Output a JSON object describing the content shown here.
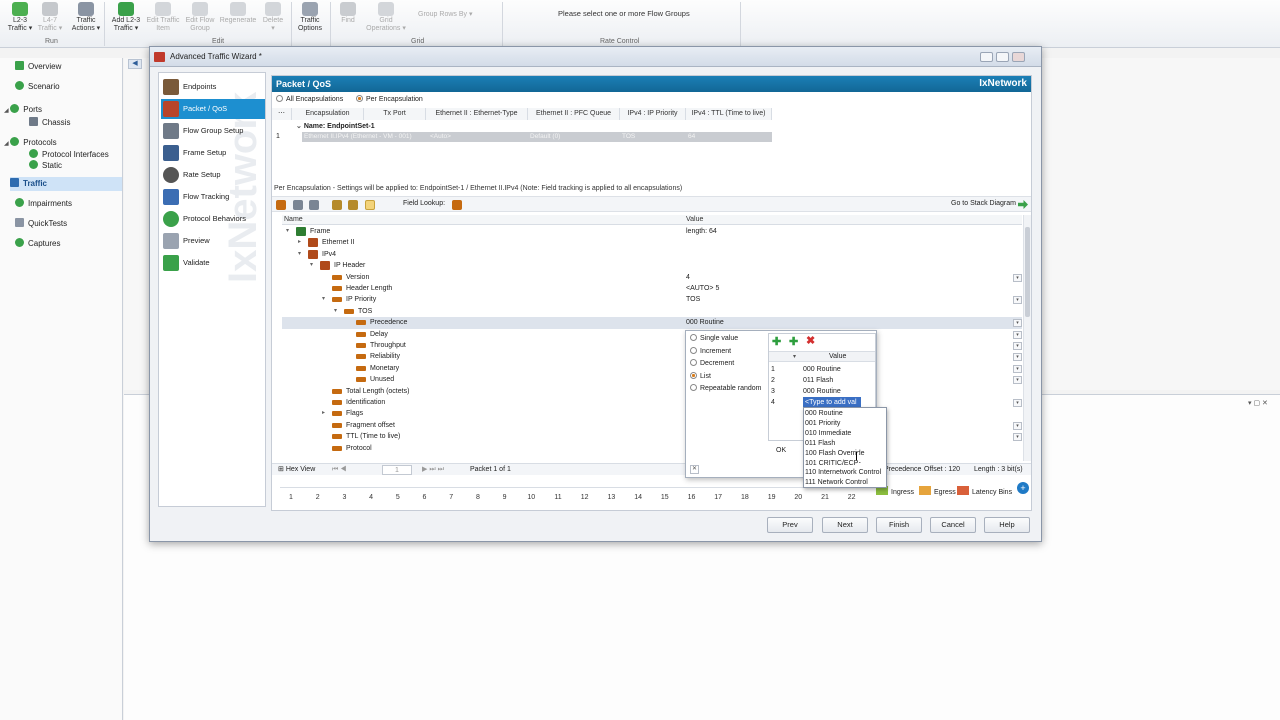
{
  "ribbon": {
    "buttons": [
      {
        "label": "L2-3\nTraffic ▾",
        "enabled": true
      },
      {
        "label": "L4-7\nTraffic ▾",
        "enabled": false
      },
      {
        "label": "Traffic\nActions ▾",
        "enabled": true
      },
      {
        "label": "Add L2-3\nTraffic ▾",
        "enabled": true
      },
      {
        "label": "Edit Traffic\nItem",
        "enabled": false
      },
      {
        "label": "Edit Flow\nGroup",
        "enabled": false
      },
      {
        "label": "Regenerate",
        "enabled": false
      },
      {
        "label": "Delete\n▾",
        "enabled": false
      },
      {
        "label": "Traffic\nOptions",
        "enabled": true
      },
      {
        "label": "Find",
        "enabled": false
      },
      {
        "label": "Grid\nOperations ▾",
        "enabled": false
      }
    ],
    "group_rows_by": "Group Rows By ▾",
    "groups": {
      "run": "Run",
      "edit": "Edit",
      "grid": "Grid",
      "rate_control": "Rate Control"
    },
    "rate_control_message": "Please select one or more Flow Groups"
  },
  "leftnav": {
    "items": [
      {
        "label": "Overview",
        "color": "#2e9e3e"
      },
      {
        "label": "Scenario",
        "color": "#2e9e3e"
      },
      {
        "label": "Ports",
        "color": "#2e9e3e"
      },
      {
        "label": "Chassis",
        "color": "#2e9e3e"
      },
      {
        "label": "Protocols",
        "color": "#2e9e3e"
      },
      {
        "label": "Protocol Interfaces",
        "color": "#2e9e3e"
      },
      {
        "label": "Static",
        "color": "#2e9e3e"
      },
      {
        "label": "Traffic",
        "color": "#2e9e3e"
      },
      {
        "label": "Impairments",
        "color": "#2e9e3e"
      },
      {
        "label": "QuickTests",
        "color": "#2e9e3e"
      },
      {
        "label": "Captures",
        "color": "#2e9e3e"
      }
    ]
  },
  "wizard": {
    "title": "Advanced Traffic Wizard *",
    "steps": [
      "Endpoints",
      "Packet / QoS",
      "Flow Group Setup",
      "Frame Setup",
      "Rate Setup",
      "Flow Tracking",
      "Protocol Behaviors",
      "Preview",
      "Validate"
    ],
    "watermark": "IxNetwork",
    "header": "Packet / QoS",
    "brand": "IxNetwork",
    "radio_all": "All Encapsulations",
    "radio_per": "Per Encapsulation",
    "columns": [
      "Encapsulation",
      "Tx Port",
      "Ethernet II : Ethernet-Type",
      "Ethernet II : PFC Queue",
      "IPv4 : IP Priority",
      "IPv4 : TTL (Time to live)"
    ],
    "endpoint_set": "Name: EndpointSet-1",
    "row_index": "1",
    "row_cells": [
      "Ethernet II.IPv4 (Ethernet - VM - 001)",
      "<Auto>",
      "Default (0)",
      "TOS",
      "64"
    ],
    "note": "Per Encapsulation - Settings will be applied to: EndpointSet-1 / Ethernet II.IPv4  (Note: Field tracking is applied to all encapsulations)",
    "field_lookup": "Field Lookup:",
    "stack_diagram": "Go to Stack Diagram",
    "grid_head": {
      "name": "Name",
      "value": "Value"
    },
    "tree": [
      {
        "name": "Frame",
        "value": "length: 64",
        "level": 0,
        "dd": false
      },
      {
        "name": "Ethernet II",
        "value": "",
        "level": 1,
        "dd": false
      },
      {
        "name": "IPv4",
        "value": "",
        "level": 1,
        "dd": false
      },
      {
        "name": "IP Header",
        "value": "",
        "level": 2,
        "dd": false
      },
      {
        "name": "Version",
        "value": "4",
        "level": 3,
        "dd": true
      },
      {
        "name": "Header Length",
        "value": "<AUTO> 5",
        "level": 3,
        "dd": false
      },
      {
        "name": "IP Priority",
        "value": "TOS",
        "level": 3,
        "dd": true
      },
      {
        "name": "TOS",
        "value": "",
        "level": 4,
        "dd": false
      },
      {
        "name": "Precedence",
        "value": "000 Routine",
        "level": 5,
        "dd": true
      },
      {
        "name": "Delay",
        "value": "",
        "level": 5,
        "dd": true
      },
      {
        "name": "Throughput",
        "value": "",
        "level": 5,
        "dd": true
      },
      {
        "name": "Reliability",
        "value": "",
        "level": 5,
        "dd": true
      },
      {
        "name": "Monetary",
        "value": "",
        "level": 5,
        "dd": true
      },
      {
        "name": "Unused",
        "value": "",
        "level": 5,
        "dd": true
      },
      {
        "name": "Total Length (octets)",
        "value": "",
        "level": 3,
        "dd": false
      },
      {
        "name": "Identification",
        "value": "",
        "level": 3,
        "dd": true
      },
      {
        "name": "Flags",
        "value": "",
        "level": 3,
        "dd": false
      },
      {
        "name": "Fragment offset",
        "value": "",
        "level": 3,
        "dd": true
      },
      {
        "name": "TTL (Time to live)",
        "value": "",
        "level": 3,
        "dd": true
      },
      {
        "name": "Protocol",
        "value": "",
        "level": 3,
        "dd": false
      }
    ],
    "hexbar": {
      "hex_view": "Hex View",
      "page": "1",
      "packet": "Packet 1 of 1",
      "precedence": "Precedence",
      "offset": "Offset : 120",
      "length": "Length : 3 bit(s)"
    },
    "ruler": [
      "1",
      "2",
      "3",
      "4",
      "5",
      "6",
      "7",
      "8",
      "9",
      "10",
      "11",
      "12",
      "13",
      "14",
      "15",
      "16",
      "17",
      "18",
      "19",
      "20",
      "21",
      "22"
    ],
    "legend": [
      {
        "label": "Ingress",
        "color": "#8cbf3f"
      },
      {
        "label": "Egress",
        "color": "#e6a43c"
      },
      {
        "label": "Latency Bins",
        "color": "#d9603a"
      }
    ],
    "footer": [
      "Prev",
      "Next",
      "Finish",
      "Cancel",
      "Help"
    ]
  },
  "popup": {
    "modes": [
      "Single value",
      "Increment",
      "Decrement",
      "List",
      "Repeatable random"
    ],
    "selected_mode": "List",
    "list_header": "Value",
    "list": [
      {
        "i": "1",
        "v": "000 Routine"
      },
      {
        "i": "2",
        "v": "011 Flash"
      },
      {
        "i": "3",
        "v": "000 Routine"
      },
      {
        "i": "4",
        "v": "<Type to add val"
      }
    ],
    "ok": "OK",
    "dropdown": [
      "000 Routine",
      "001 Priority",
      "010 Immediate",
      "011 Flash",
      "100 Flash Override",
      "101 CRITIC/ECP",
      "110 Internetwork Control",
      "111 Network Control"
    ]
  }
}
